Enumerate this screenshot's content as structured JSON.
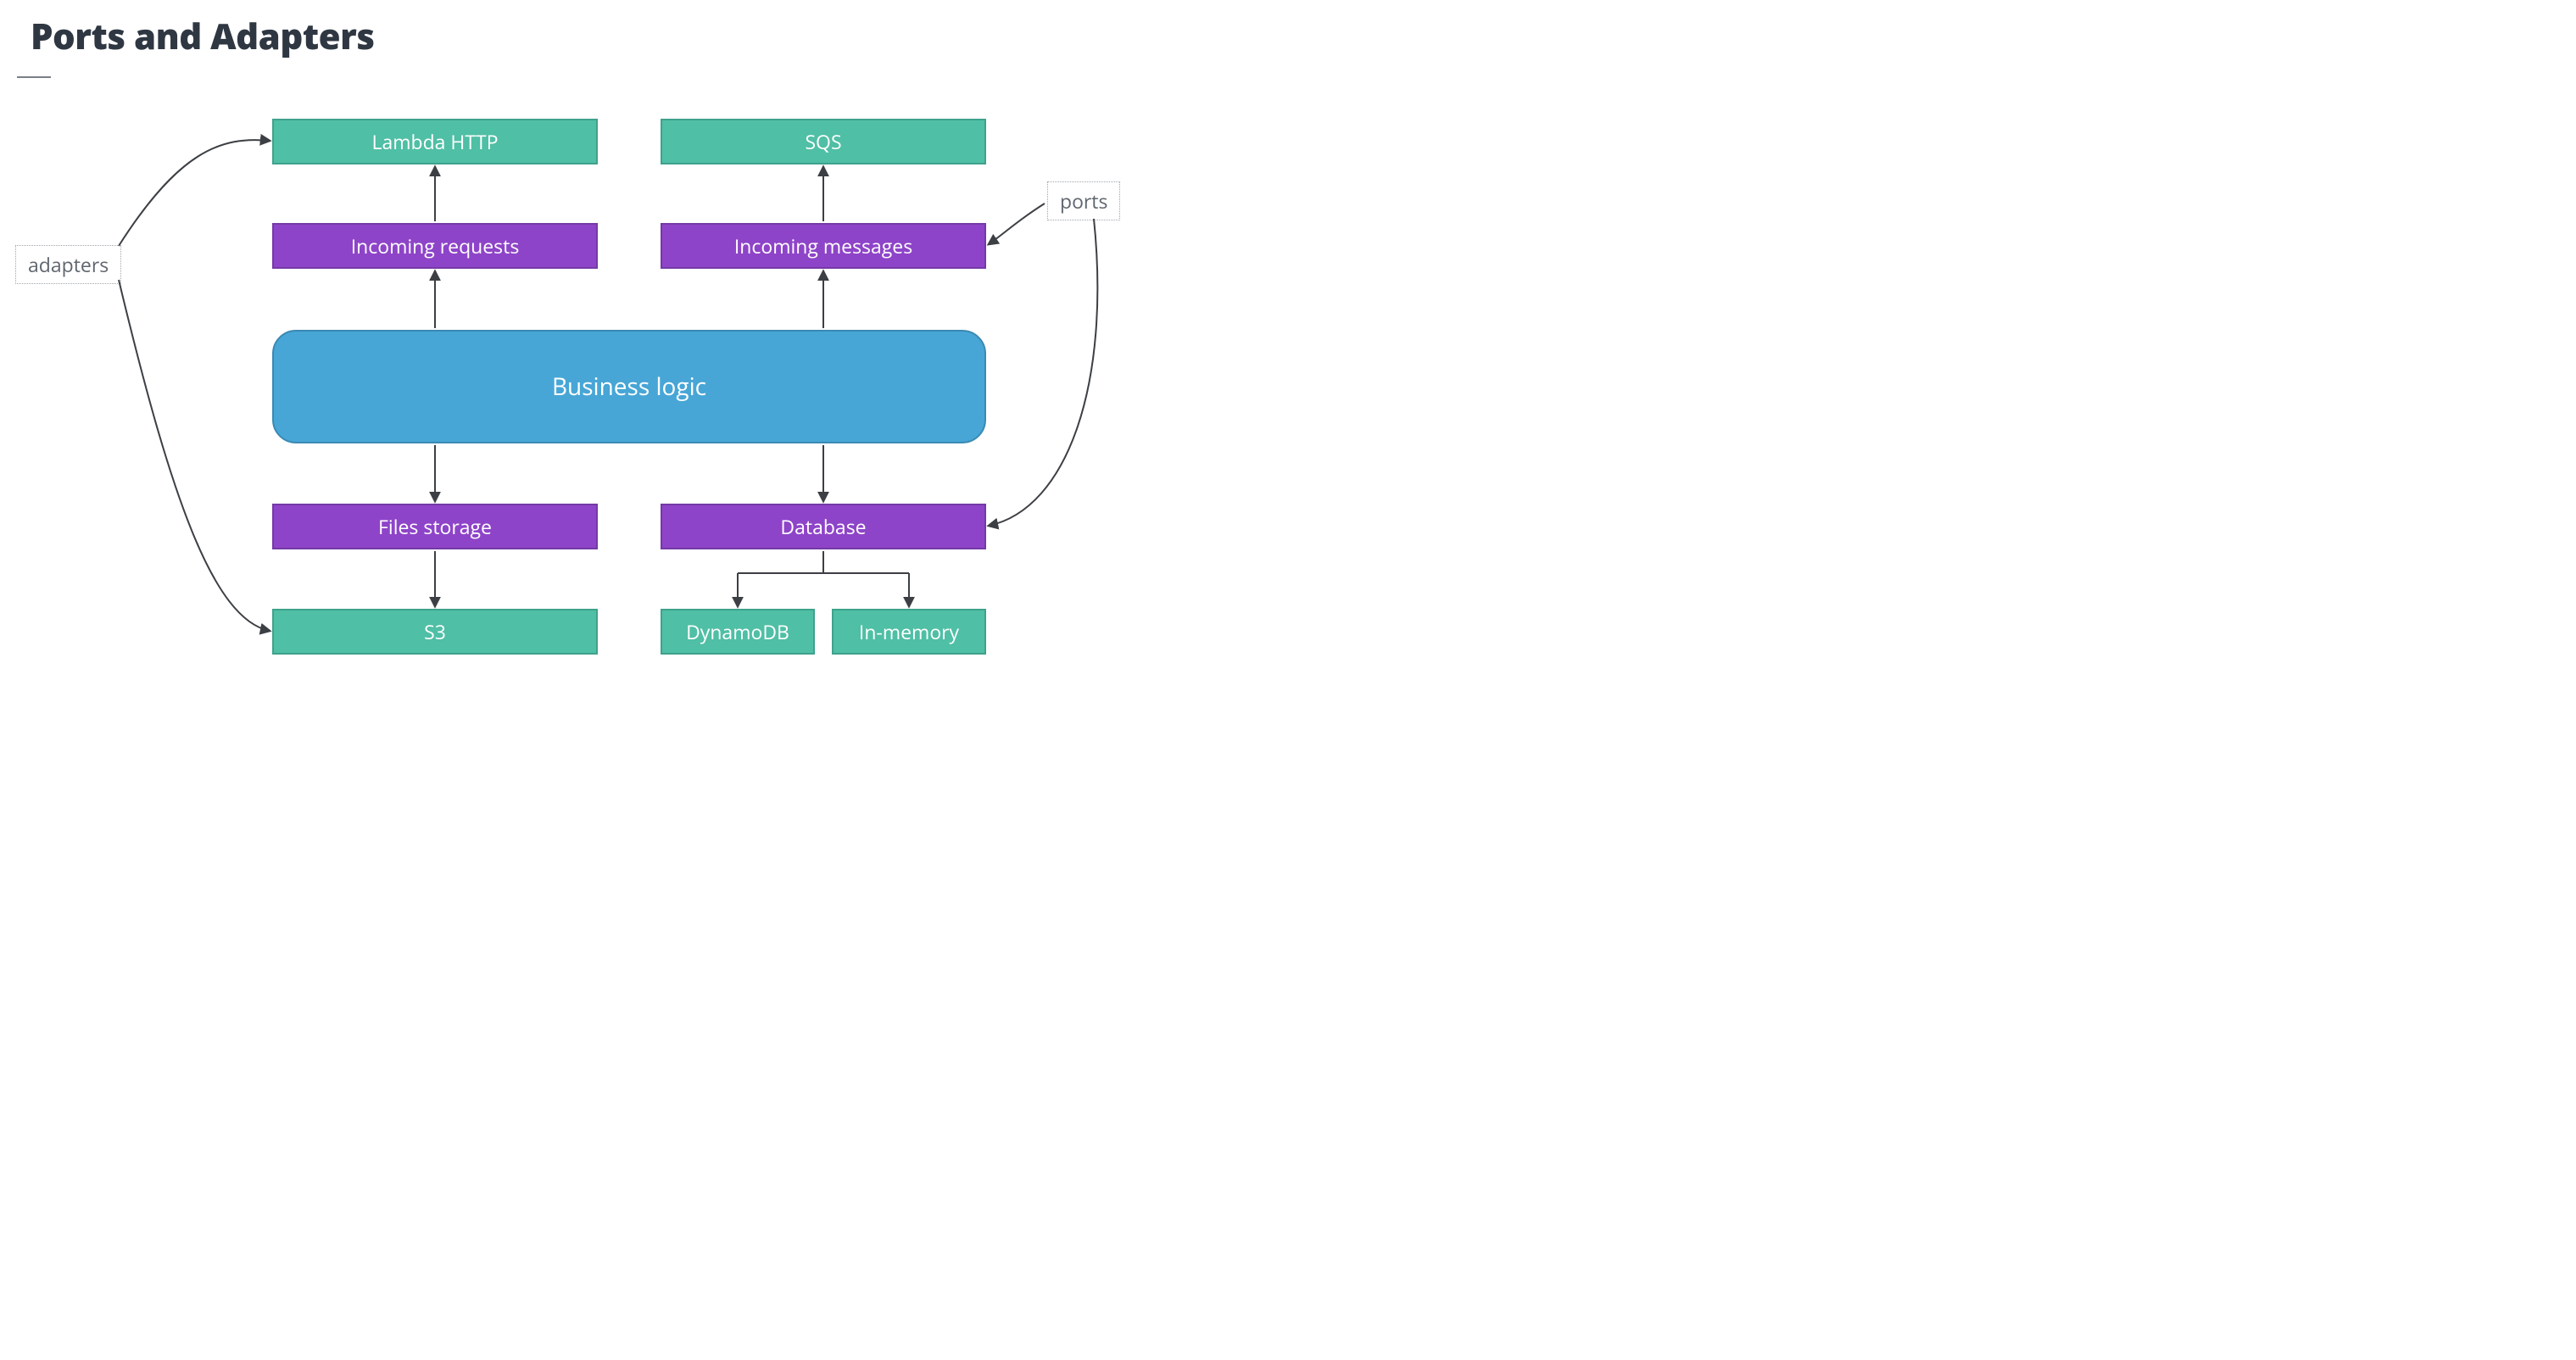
{
  "title": "Ports and Adapters",
  "labels": {
    "adapters": "adapters",
    "ports": "ports"
  },
  "nodes": {
    "lambda_http": "Lambda HTTP",
    "sqs": "SQS",
    "incoming_requests": "Incoming requests",
    "incoming_messages": "Incoming messages",
    "business_logic": "Business logic",
    "files_storage": "Files storage",
    "database": "Database",
    "s3": "S3",
    "dynamodb": "DynamoDB",
    "in_memory": "In-memory"
  },
  "colors": {
    "adapter": "#4fbfa5",
    "port": "#8e44c8",
    "core": "#47a6d6",
    "arrow": "#3c3f44"
  },
  "diagram": {
    "description": "Ports and Adapters (hexagonal) architecture",
    "core": "Business logic",
    "ports": [
      {
        "name": "Incoming requests",
        "direction": "in",
        "adapters": [
          "Lambda HTTP"
        ]
      },
      {
        "name": "Incoming messages",
        "direction": "in",
        "adapters": [
          "SQS"
        ]
      },
      {
        "name": "Files storage",
        "direction": "out",
        "adapters": [
          "S3"
        ]
      },
      {
        "name": "Database",
        "direction": "out",
        "adapters": [
          "DynamoDB",
          "In-memory"
        ]
      }
    ],
    "annotations": [
      {
        "label": "adapters",
        "points_to": [
          "Lambda HTTP",
          "S3"
        ]
      },
      {
        "label": "ports",
        "points_to": [
          "Incoming messages",
          "Database"
        ]
      }
    ]
  }
}
